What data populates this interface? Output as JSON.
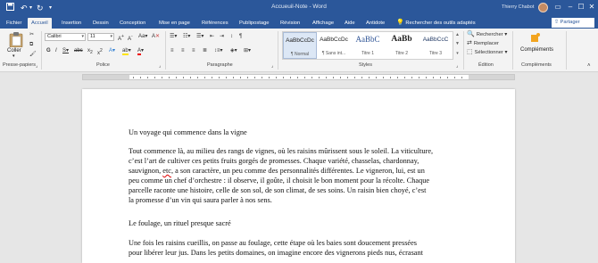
{
  "titlebar": {
    "title": "Accueuil-Note - Word",
    "user": "Thierry Chabot",
    "icons": [
      "save-icon",
      "undo-icon",
      "redo-icon",
      "customize-icon"
    ]
  },
  "tabs": {
    "file": "Fichier",
    "items": [
      "Accueil",
      "Insertion",
      "Dessin",
      "Conception",
      "Mise en page",
      "Références",
      "Publipostage",
      "Révision",
      "Affichage",
      "Aide",
      "Antidote"
    ],
    "active": "Accueil",
    "tell_me": "Rechercher des outils adaptés",
    "share": "Partager"
  },
  "ribbon": {
    "clipboard": {
      "paste": "Coller",
      "label": "Presse-papiers"
    },
    "font": {
      "name": "Calibri",
      "size": "11",
      "label": "Police"
    },
    "paragraph": {
      "label": "Paragraphe"
    },
    "styles": {
      "label": "Styles",
      "items": [
        {
          "sample": "AaBbCcDc",
          "name": "¶ Normal"
        },
        {
          "sample": "AaBbCcDc",
          "name": "¶ Sans int..."
        },
        {
          "sample": "AaBbC",
          "name": "Titre 1"
        },
        {
          "sample": "AaBb",
          "name": "Titre 2"
        },
        {
          "sample": "AaBbCcC",
          "name": "Titre 3"
        }
      ]
    },
    "editing": {
      "label": "Édition",
      "find": "Rechercher",
      "replace": "Remplacer",
      "select": "Sélectionner"
    },
    "addins": {
      "button": "Compléments",
      "label": "Compléments"
    }
  },
  "document": {
    "heading1": "Un voyage qui commence dans la vigne",
    "para1_lines": [
      "Tout commence là, au milieu des rangs de vignes, où les raisins mûrissent sous le soleil. La viticulture,",
      "c’est l’art de cultiver ces petits fruits gorgés de promesses. Chaque variété, chasselas, chardonnay,"
    ],
    "para1_line3_before": "sauvignon, ",
    "para1_line3_spell": "etc",
    "para1_line3_after": ", a son caractère, un peu comme des personnalités différentes. Le vigneron, lui, est un",
    "para1_lines_rest": [
      "peu comme un chef d’orchestre : il observe, il goûte, il choisit le bon moment pour la récolte. Chaque",
      "parcelle raconte une histoire, celle de son sol, de son climat, de ses soins. Un raisin bien choyé, c’est",
      "la promesse d’un vin qui saura parler à nos sens."
    ],
    "heading2": "Le foulage, un rituel presque sacré",
    "para2_lines": [
      "Une fois les raisins cueillis, on passe au foulage, cette étape où les baies sont doucement pressées",
      "pour libérer leur jus. Dans les petits domaines, on imagine encore des vignerons pieds nus, écrasant"
    ]
  }
}
